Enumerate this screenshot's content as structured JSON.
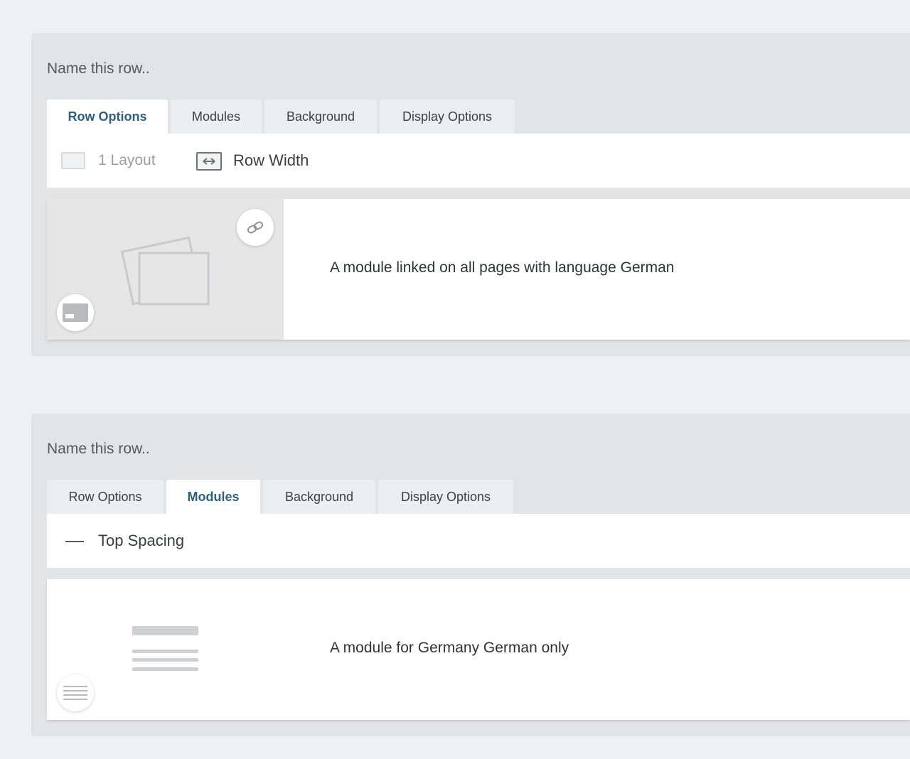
{
  "rows": [
    {
      "name_placeholder": "Name this row..",
      "tabs": [
        "Row Options",
        "Modules",
        "Background",
        "Display Options"
      ],
      "active_tab": "Row Options",
      "options": {
        "layout_label": "1 Layout",
        "width_label": "Row Width"
      },
      "module": {
        "description": "A module linked on all pages with language German",
        "thumbnail_icon": "images-icon",
        "type_icon": "image-module-icon",
        "link_icon": "link-icon"
      }
    },
    {
      "name_placeholder": "Name this row..",
      "tabs": [
        "Row Options",
        "Modules",
        "Background",
        "Display Options"
      ],
      "active_tab": "Modules",
      "options": {
        "spacing_label": "Top Spacing"
      },
      "module": {
        "description": "A module for Germany German only",
        "thumbnail_icon": "text-lines-icon",
        "type_icon": "text-module-icon"
      }
    }
  ],
  "colors": {
    "page_background": "#eff0f1",
    "panel_background": "#e3e4e6",
    "active_tab_text": "#2f5f7f"
  }
}
